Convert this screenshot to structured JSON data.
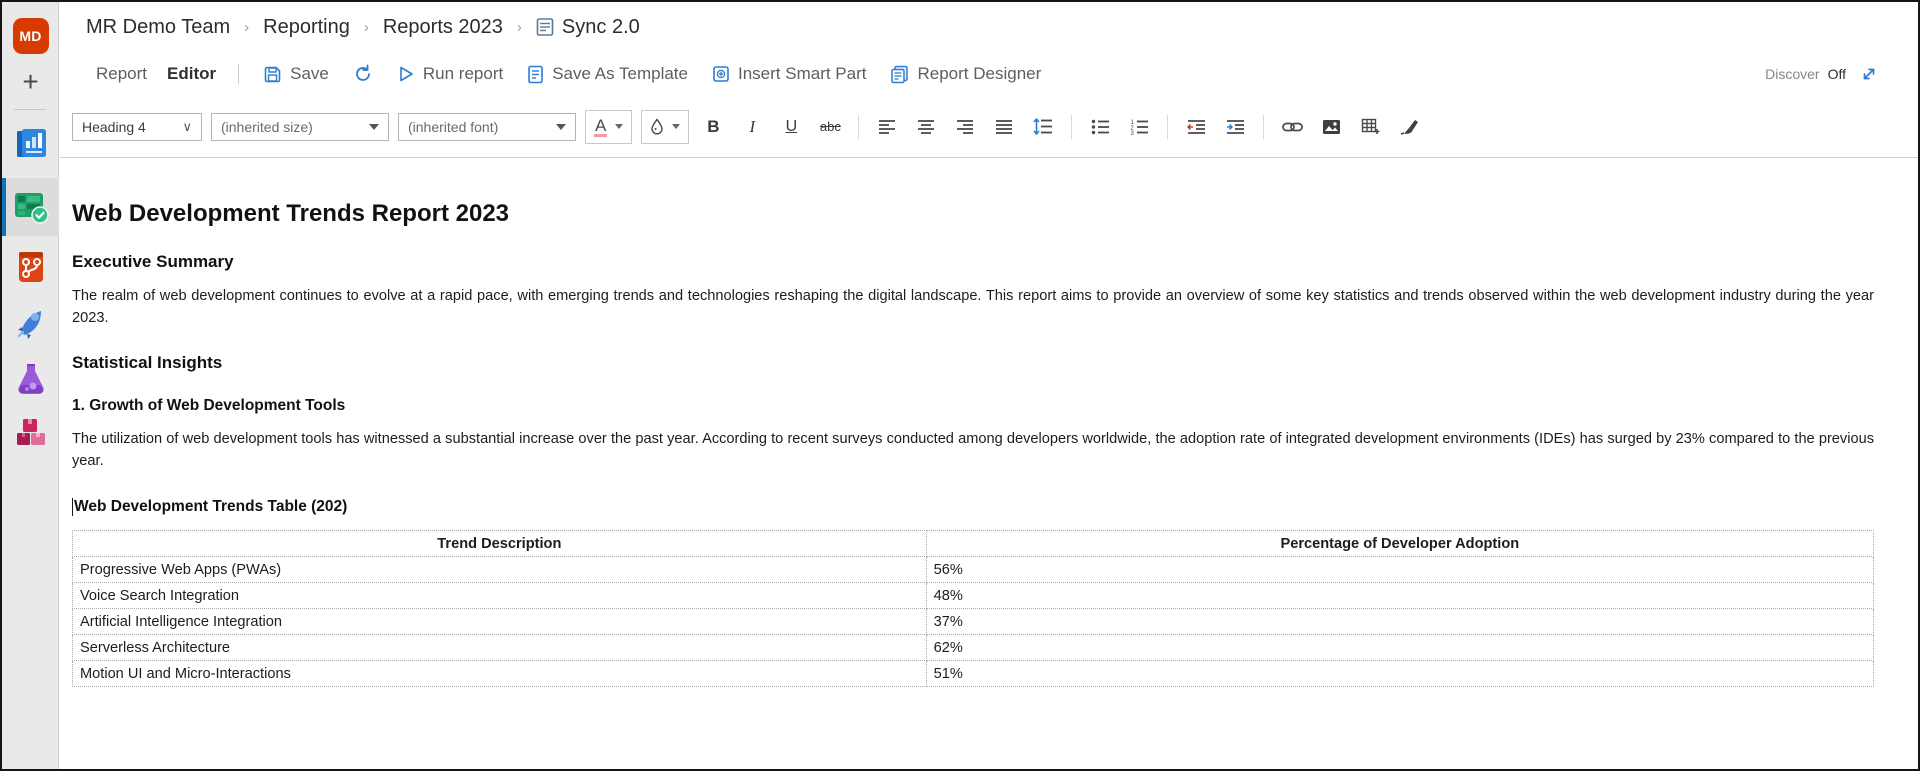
{
  "breadcrumb": {
    "items": [
      "MR Demo Team",
      "Reporting",
      "Reports 2023",
      "Sync 2.0"
    ],
    "separator": "›"
  },
  "sidebar": {
    "avatar_initials": "MD",
    "add_label": "+",
    "icons": [
      "report-icon",
      "table-check-icon",
      "branch-icon",
      "rocket-icon",
      "flask-icon",
      "boxes-icon"
    ]
  },
  "actionbar": {
    "tabs": [
      {
        "label": "Report"
      },
      {
        "label": "Editor"
      }
    ],
    "buttons": {
      "save": "Save",
      "run_report": "Run report",
      "save_as_template": "Save As Template",
      "insert_smart_part": "Insert Smart Part",
      "report_designer": "Report Designer"
    },
    "discover_label": "Discover",
    "discover_state": "Off"
  },
  "format_toolbar": {
    "style_select": "Heading 4",
    "size_select": "(inherited size)",
    "font_select": "(inherited font)",
    "font_color_glyph": "A",
    "bold": "B",
    "italic": "I",
    "underline": "U",
    "strikethrough": "abc"
  },
  "document": {
    "title": "Web Development Trends Report 2023",
    "exec_summary_heading": "Executive Summary",
    "exec_summary_text": "The realm of web development continues to evolve at a rapid pace, with emerging trends and technologies reshaping the digital landscape. This report aims to provide an overview of some key statistics and trends observed within the web development industry during the year 2023.",
    "stats_heading": "Statistical Insights",
    "growth_heading": "1. Growth of Web Development Tools",
    "growth_text": "The utilization of web development tools has witnessed a substantial increase over the past year. According to recent surveys conducted among developers worldwide, the adoption rate of integrated development environments (IDEs) has surged by 23% compared to the previous year.",
    "table_heading": "Web Development Trends Table (202)",
    "table": {
      "headers": [
        "Trend Description",
        "Percentage of Developer Adoption"
      ],
      "rows": [
        [
          "Progressive Web Apps (PWAs)",
          "56%"
        ],
        [
          "Voice Search Integration",
          "48%"
        ],
        [
          "Artificial Intelligence Integration",
          "37%"
        ],
        [
          "Serverless Architecture",
          "62%"
        ],
        [
          "Motion UI and Micro-Interactions",
          "51%"
        ]
      ]
    }
  },
  "colors": {
    "accent_blue": "#2b7cd3",
    "avatar_red": "#d83b01",
    "active_bar_blue": "#1474bb",
    "sidebar_bg": "#e9e9e9"
  }
}
